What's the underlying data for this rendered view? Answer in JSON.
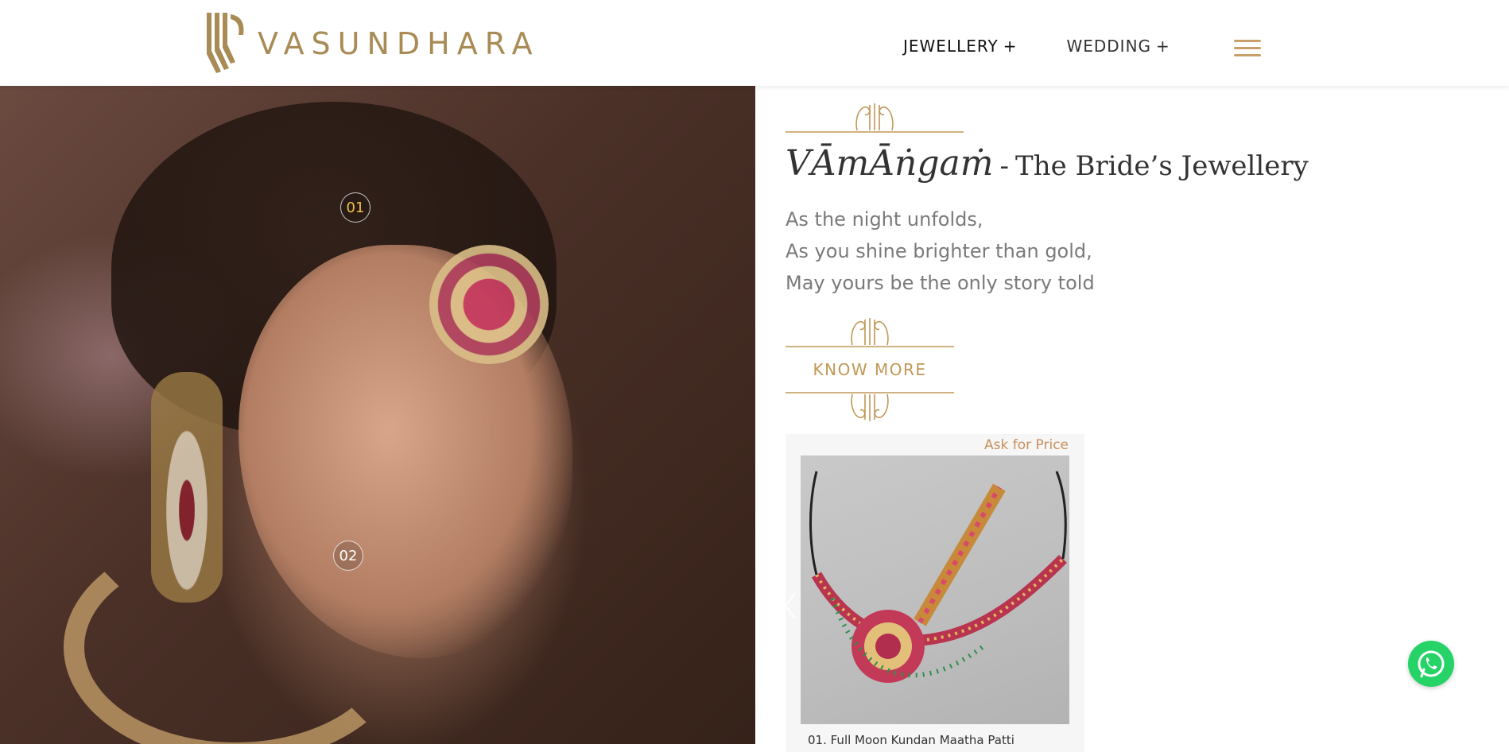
{
  "brand": {
    "name": "VASUNDHARA",
    "color": "#a88b55",
    "icon": "vasundhara-logo-icon"
  },
  "nav": {
    "items": [
      {
        "label": "JEWELLERY",
        "expand": "+",
        "color": "#111111"
      },
      {
        "label": "WEDDING",
        "expand": "+",
        "color": "#333333"
      }
    ],
    "menu_icon": "hamburger-menu-icon"
  },
  "hero": {
    "hotspots": [
      {
        "label": "01",
        "color": "#f0c040"
      },
      {
        "label": "02",
        "color": "#ffffff"
      }
    ]
  },
  "collection": {
    "title_main": "VĀmĀṅgaṁ",
    "title_separator": "-",
    "title_sub": "The Bride’s Jewellery",
    "poem": [
      "As the night unfolds,",
      "As you shine brighter than gold,",
      "May yours be the only story told"
    ],
    "cta_label": "KNOW MORE",
    "accent_color": "#c09857"
  },
  "product": {
    "ask_label": "Ask for Price",
    "name": "01. Full Moon Kundan Maatha Patti",
    "image_icon": "kundan-maatha-patti-image"
  },
  "carousel": {
    "prev_icon": "chevron-left-icon"
  },
  "floating": {
    "whatsapp_icon": "whatsapp-icon",
    "whatsapp_color": "#25d366"
  }
}
